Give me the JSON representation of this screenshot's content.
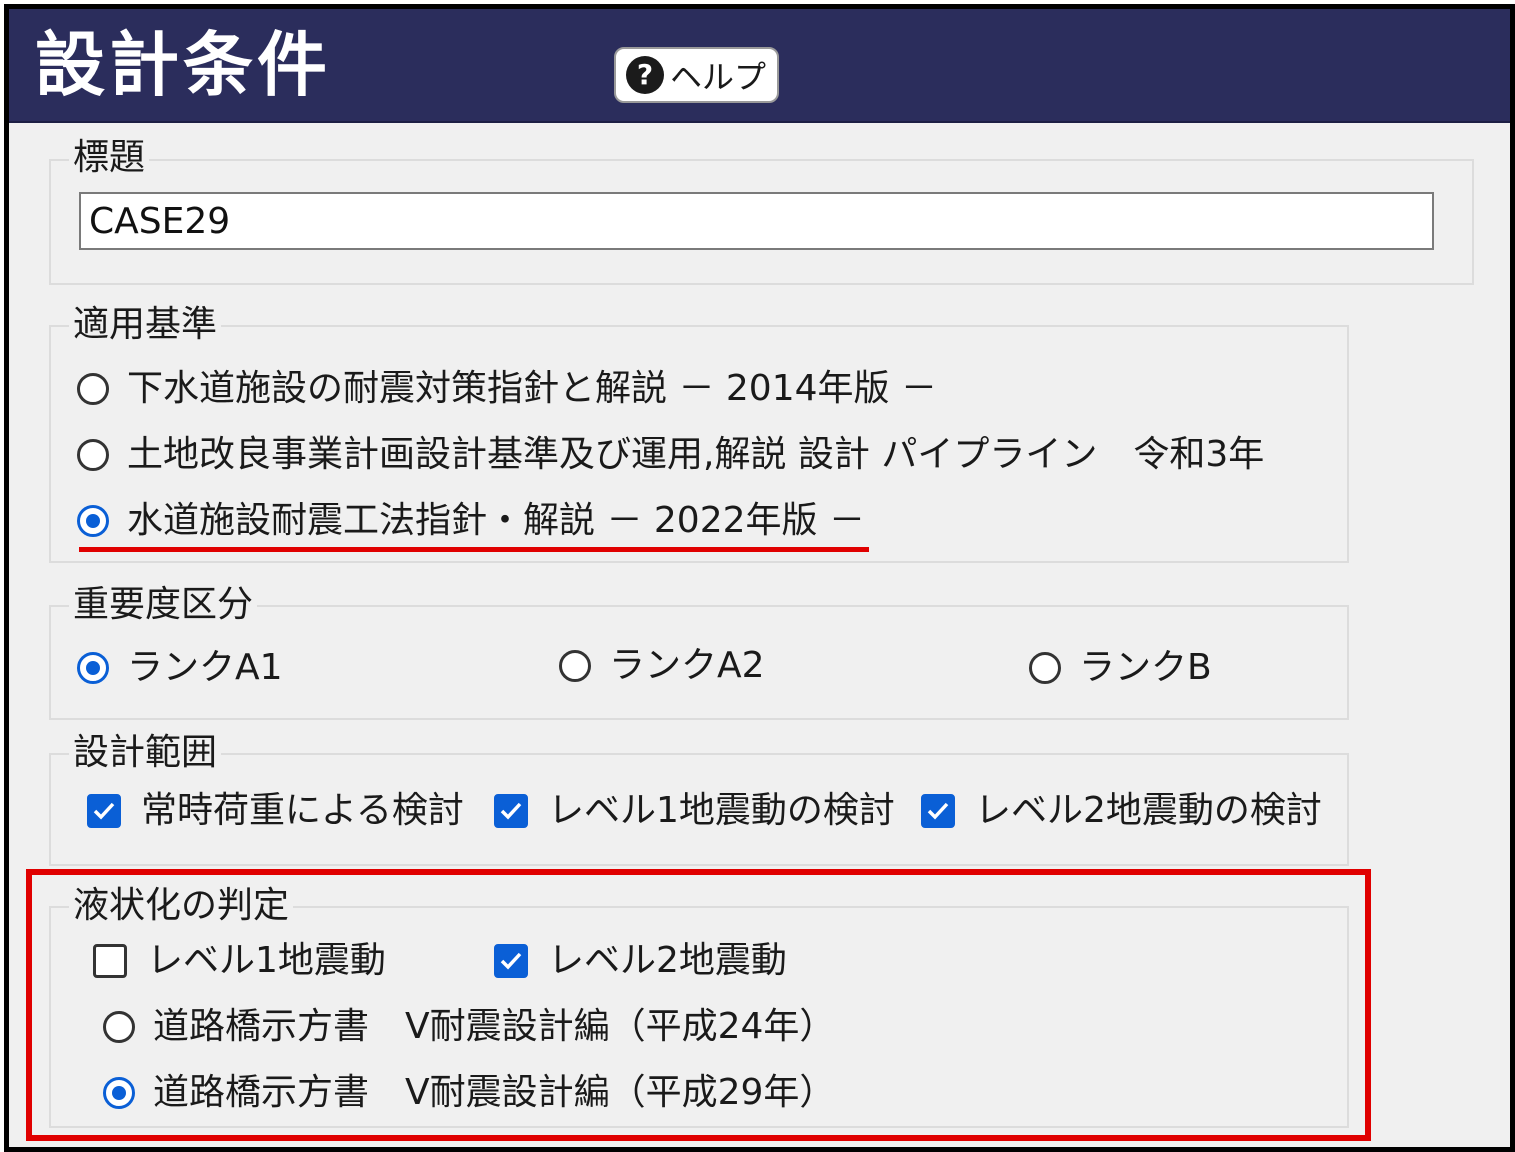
{
  "window": {
    "title": "設計条件",
    "help_label": "ヘルプ"
  },
  "title_group": {
    "legend": "標題",
    "value": "CASE29"
  },
  "standard_group": {
    "legend": "適用基準",
    "options": [
      {
        "label": "下水道施設の耐震対策指針と解説 － 2014年版 －",
        "selected": false
      },
      {
        "label": "土地改良事業計画設計基準及び運用,解説 設計 パイプライン　令和3年",
        "selected": false
      },
      {
        "label": "水道施設耐震工法指針・解説 － 2022年版 －",
        "selected": true
      }
    ]
  },
  "importance_group": {
    "legend": "重要度区分",
    "options": [
      {
        "label": "ランクA1",
        "selected": true
      },
      {
        "label": "ランクA2",
        "selected": false
      },
      {
        "label": "ランクB",
        "selected": false
      }
    ]
  },
  "scope_group": {
    "legend": "設計範囲",
    "checks": [
      {
        "label": "常時荷重による検討",
        "checked": true
      },
      {
        "label": "レベル1地震動の検討",
        "checked": true
      },
      {
        "label": "レベル2地震動の検討",
        "checked": true
      }
    ]
  },
  "liquefaction_group": {
    "legend": "液状化の判定",
    "checks": [
      {
        "label": "レベル1地震動",
        "checked": false
      },
      {
        "label": "レベル2地震動",
        "checked": true
      }
    ],
    "options": [
      {
        "label": "道路橋示方書　V耐震設計編（平成24年）",
        "selected": false
      },
      {
        "label": "道路橋示方書　V耐震設計編（平成29年）",
        "selected": true
      }
    ]
  },
  "colors": {
    "header_bg": "#2b2d5c",
    "accent": "#0a5fd6",
    "highlight": "#e00000"
  }
}
